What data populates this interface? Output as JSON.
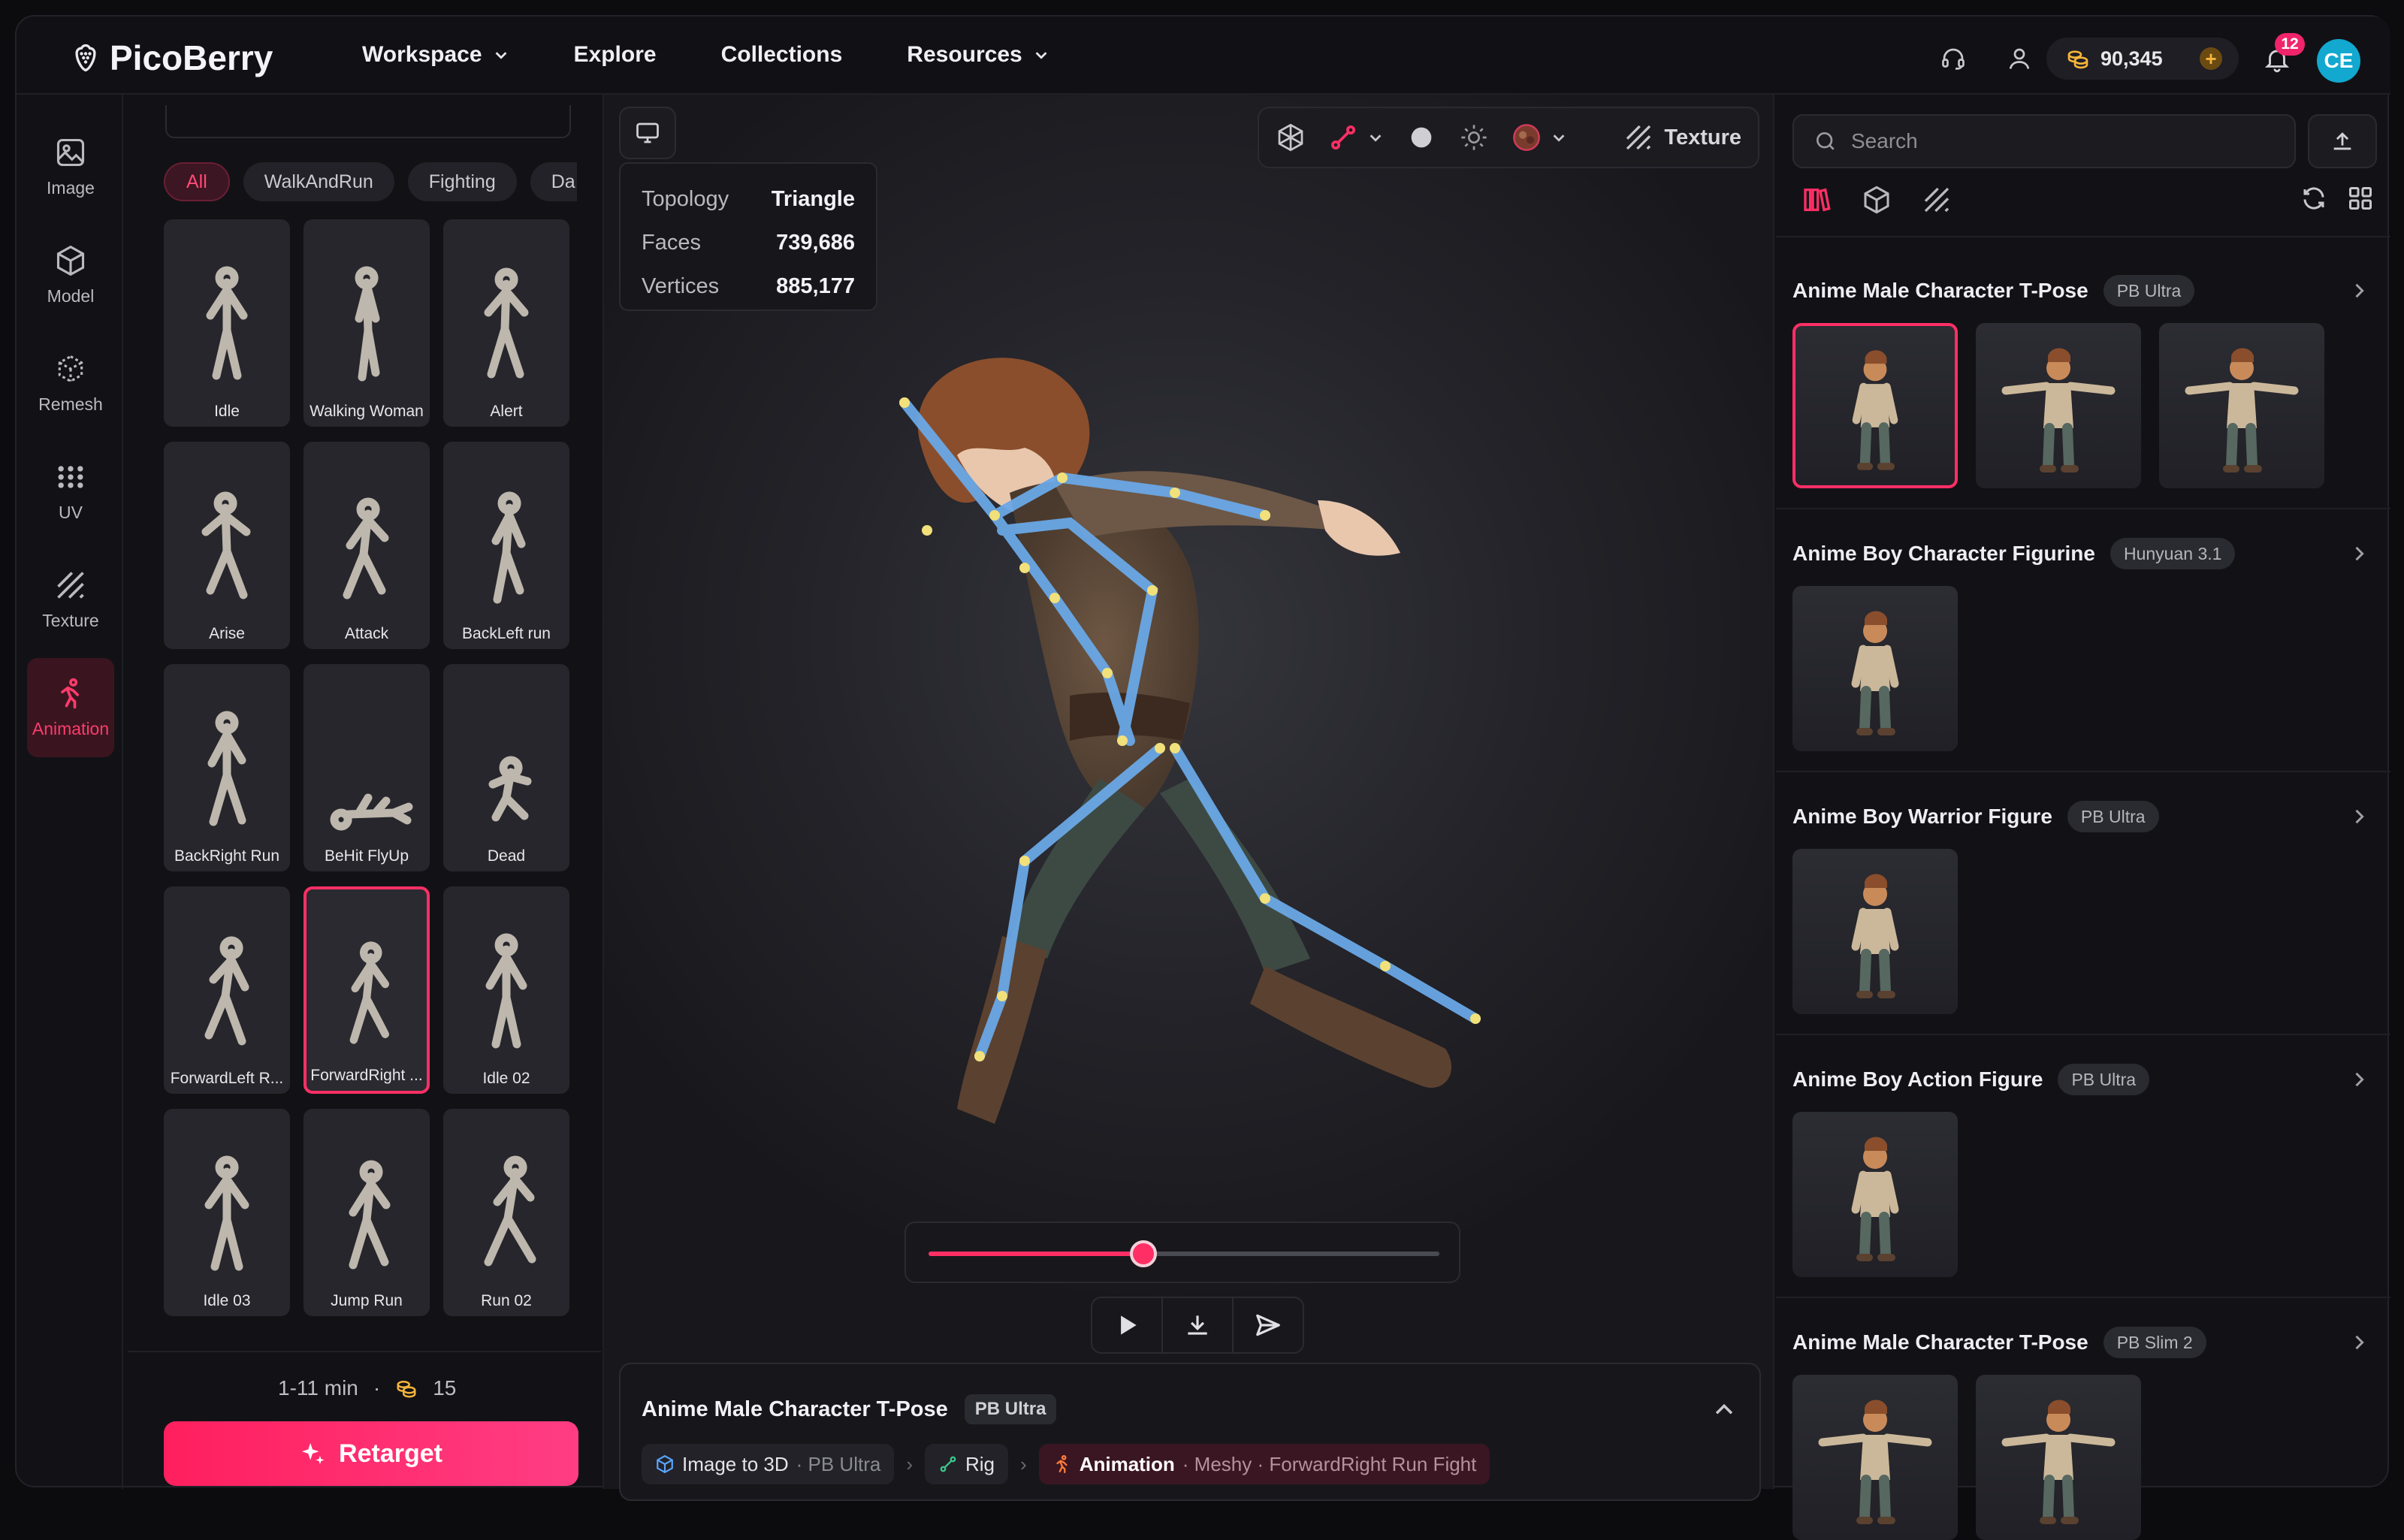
{
  "brand": {
    "name": "PicoBerry"
  },
  "nav": [
    {
      "label": "Workspace",
      "dropdown": true
    },
    {
      "label": "Explore",
      "dropdown": false
    },
    {
      "label": "Collections",
      "dropdown": false
    },
    {
      "label": "Resources",
      "dropdown": true
    }
  ],
  "header": {
    "credits": "90,345",
    "notifications": "12",
    "avatar_initials": "CE"
  },
  "tools": [
    {
      "label": "Image",
      "icon": "image-icon"
    },
    {
      "label": "Model",
      "icon": "cube-icon"
    },
    {
      "label": "Remesh",
      "icon": "remesh-icon"
    },
    {
      "label": "UV",
      "icon": "uv-grid-icon"
    },
    {
      "label": "Texture",
      "icon": "texture-icon"
    },
    {
      "label": "Animation",
      "icon": "running-figure-icon",
      "active": true
    }
  ],
  "library": {
    "filters": [
      "All",
      "WalkAndRun",
      "Fighting",
      "Da"
    ],
    "active_filter": "All",
    "animations": [
      "Idle",
      "Walking Woman",
      "Alert",
      "Arise",
      "Attack",
      "BackLeft run",
      "BackRight Run",
      "BeHit FlyUp",
      "Dead",
      "ForwardLeft R...",
      "ForwardRight ...",
      "Idle 02",
      "Idle 03",
      "Jump Run",
      "Run 02"
    ],
    "selected": "ForwardRight ...",
    "duration": "1-11 min",
    "cost": "15",
    "retarget_label": "Retarget"
  },
  "viewport": {
    "stats": [
      {
        "label": "Topology",
        "value": "Triangle"
      },
      {
        "label": "Faces",
        "value": "739,686"
      },
      {
        "label": "Vertices",
        "value": "885,177"
      }
    ],
    "texture_label": "Texture",
    "timeline_progress": 0.42,
    "model_title": "Anime Male Character T-Pose",
    "model_badge": "PB Ultra",
    "pipeline": [
      {
        "label": "Image to 3D",
        "detail": "· PB Ultra"
      },
      {
        "label": "Rig",
        "detail": ""
      },
      {
        "label": "Animation",
        "detail": "· Meshy · ForwardRight Run Fight"
      }
    ]
  },
  "assets": {
    "search_placeholder": "Search",
    "groups": [
      {
        "title": "Anime Male Character T-Pose",
        "badge": "PB Ultra",
        "thumbs": 3
      },
      {
        "title": "Anime Boy Character Figurine",
        "badge": "Hunyuan 3.1",
        "thumbs": 1
      },
      {
        "title": "Anime Boy Warrior Figure",
        "badge": "PB Ultra",
        "thumbs": 1
      },
      {
        "title": "Anime Boy Action Figure",
        "badge": "PB Ultra",
        "thumbs": 1
      },
      {
        "title": "Anime Male Character T-Pose",
        "badge": "PB Slim 2",
        "thumbs": 2
      }
    ]
  },
  "colors": {
    "accent": "#ff2f66",
    "credits_gold": "#f5b53b",
    "avatar": "#12a8cf"
  }
}
